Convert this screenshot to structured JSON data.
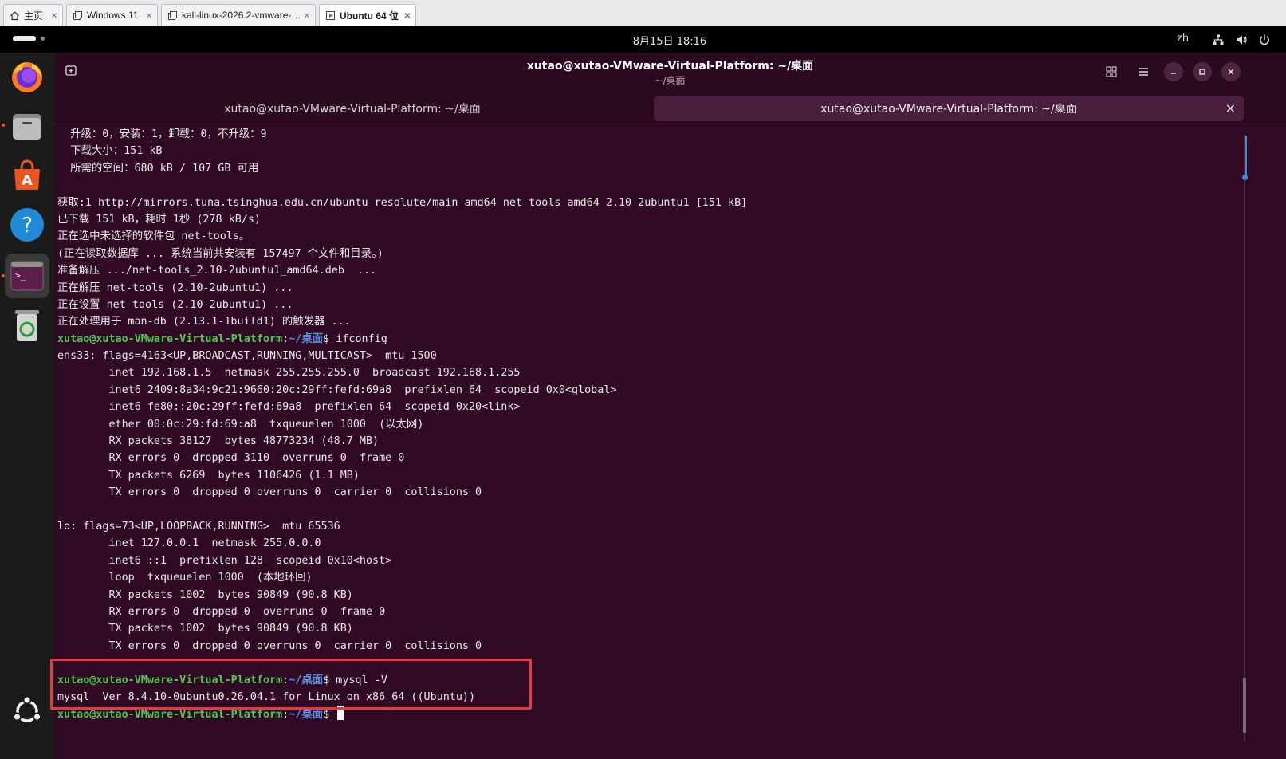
{
  "vm_tabs": [
    {
      "label": "主页",
      "icon": "home-icon"
    },
    {
      "label": "Windows 11",
      "icon": "vm-icon"
    },
    {
      "label": "kali-linux-2026.2-vmware-am...",
      "icon": "vm-icon"
    },
    {
      "label": "Ubuntu 64 位",
      "icon": "vm-running-icon"
    }
  ],
  "topbar": {
    "clock": "8月15日  18:16",
    "lang": "zh"
  },
  "window": {
    "title": "xutao@xutao-VMware-Virtual-Platform: ~/桌面",
    "subtitle": "~/桌面"
  },
  "term_tabs": [
    {
      "label": "xutao@xutao-VMware-Virtual-Platform: ~/桌面"
    },
    {
      "label": "xutao@xutao-VMware-Virtual-Platform: ~/桌面"
    }
  ],
  "prompt": {
    "user": "xutao@xutao-VMware-Virtual-Platform",
    "sep": ":",
    "path": "~/桌面",
    "sym": "$ "
  },
  "terminal": {
    "pre": [
      "  升级：0，安装：1，卸载：0，不升级：9",
      "  下载大小：151 kB",
      "  所需的空间：680 kB / 107 GB 可用",
      "",
      "获取:1 http://mirrors.tuna.tsinghua.edu.cn/ubuntu resolute/main amd64 net-tools amd64 2.10-2ubuntu1 [151 kB]",
      "已下载 151 kB，耗时 1秒 (278 kB/s)",
      "正在选中未选择的软件包 net-tools。",
      "(正在读取数据库 ... 系统当前共安装有 157497 个文件和目录。)",
      "准备解压 .../net-tools_2.10-2ubuntu1_amd64.deb  ...",
      "正在解压 net-tools (2.10-2ubuntu1) ...",
      "正在设置 net-tools (2.10-2ubuntu1) ...",
      "正在处理用于 man-db (2.13.1-1build1) 的触发器 ..."
    ],
    "cmd1": "ifconfig",
    "ifconfig": [
      "ens33: flags=4163<UP,BROADCAST,RUNNING,MULTICAST>  mtu 1500",
      "        inet 192.168.1.5  netmask 255.255.255.0  broadcast 192.168.1.255",
      "        inet6 2409:8a34:9c21:9660:20c:29ff:fefd:69a8  prefixlen 64  scopeid 0x0<global>",
      "        inet6 fe80::20c:29ff:fefd:69a8  prefixlen 64  scopeid 0x20<link>",
      "        ether 00:0c:29:fd:69:a8  txqueuelen 1000  (以太网)",
      "        RX packets 38127  bytes 48773234 (48.7 MB)",
      "        RX errors 0  dropped 3110  overruns 0  frame 0",
      "        TX packets 6269  bytes 1106426 (1.1 MB)",
      "        TX errors 0  dropped 0 overruns 0  carrier 0  collisions 0",
      "",
      "lo: flags=73<UP,LOOPBACK,RUNNING>  mtu 65536",
      "        inet 127.0.0.1  netmask 255.0.0.0",
      "        inet6 ::1  prefixlen 128  scopeid 0x10<host>",
      "        loop  txqueuelen 1000  (本地环回)",
      "        RX packets 1002  bytes 90849 (90.8 KB)",
      "        RX errors 0  dropped 0  overruns 0  frame 0",
      "        TX packets 1002  bytes 90849 (90.8 KB)",
      "        TX errors 0  dropped 0 overruns 0  carrier 0  collisions 0",
      ""
    ],
    "cmd2": "mysql -V",
    "mysql_out": "mysql  Ver 8.4.10-0ubuntu0.26.04.1 for Linux on x86_64 ((Ubuntu))"
  },
  "colors": {
    "terminal_bg": "#300a24",
    "prompt_user": "#4ec94e",
    "prompt_path": "#5a8ee0",
    "highlight": "#e83a3a",
    "accent": "#e95420"
  }
}
